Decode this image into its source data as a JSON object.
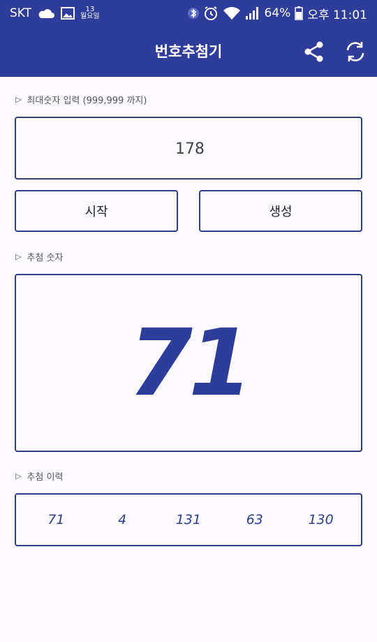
{
  "status": {
    "carrier": "SKT",
    "date_top": "13",
    "date_bottom": "월요일",
    "battery": "64%",
    "time": "오후 11:01"
  },
  "appbar": {
    "title": "번호추첨기",
    "icons": [
      "share-icon",
      "refresh-icon"
    ]
  },
  "max_input": {
    "label": "최대숫자 입력 (999,999 까지)",
    "value": "178"
  },
  "buttons": {
    "start_label": "시작",
    "generate_label": "생성"
  },
  "result": {
    "label": "추첨 숫자",
    "number": "71"
  },
  "history": {
    "label": "추첨 이력",
    "items": [
      "71",
      "4",
      "131",
      "63",
      "130"
    ]
  },
  "colors": {
    "primary": "#2f3d9a",
    "border": "#2f3d8a"
  }
}
